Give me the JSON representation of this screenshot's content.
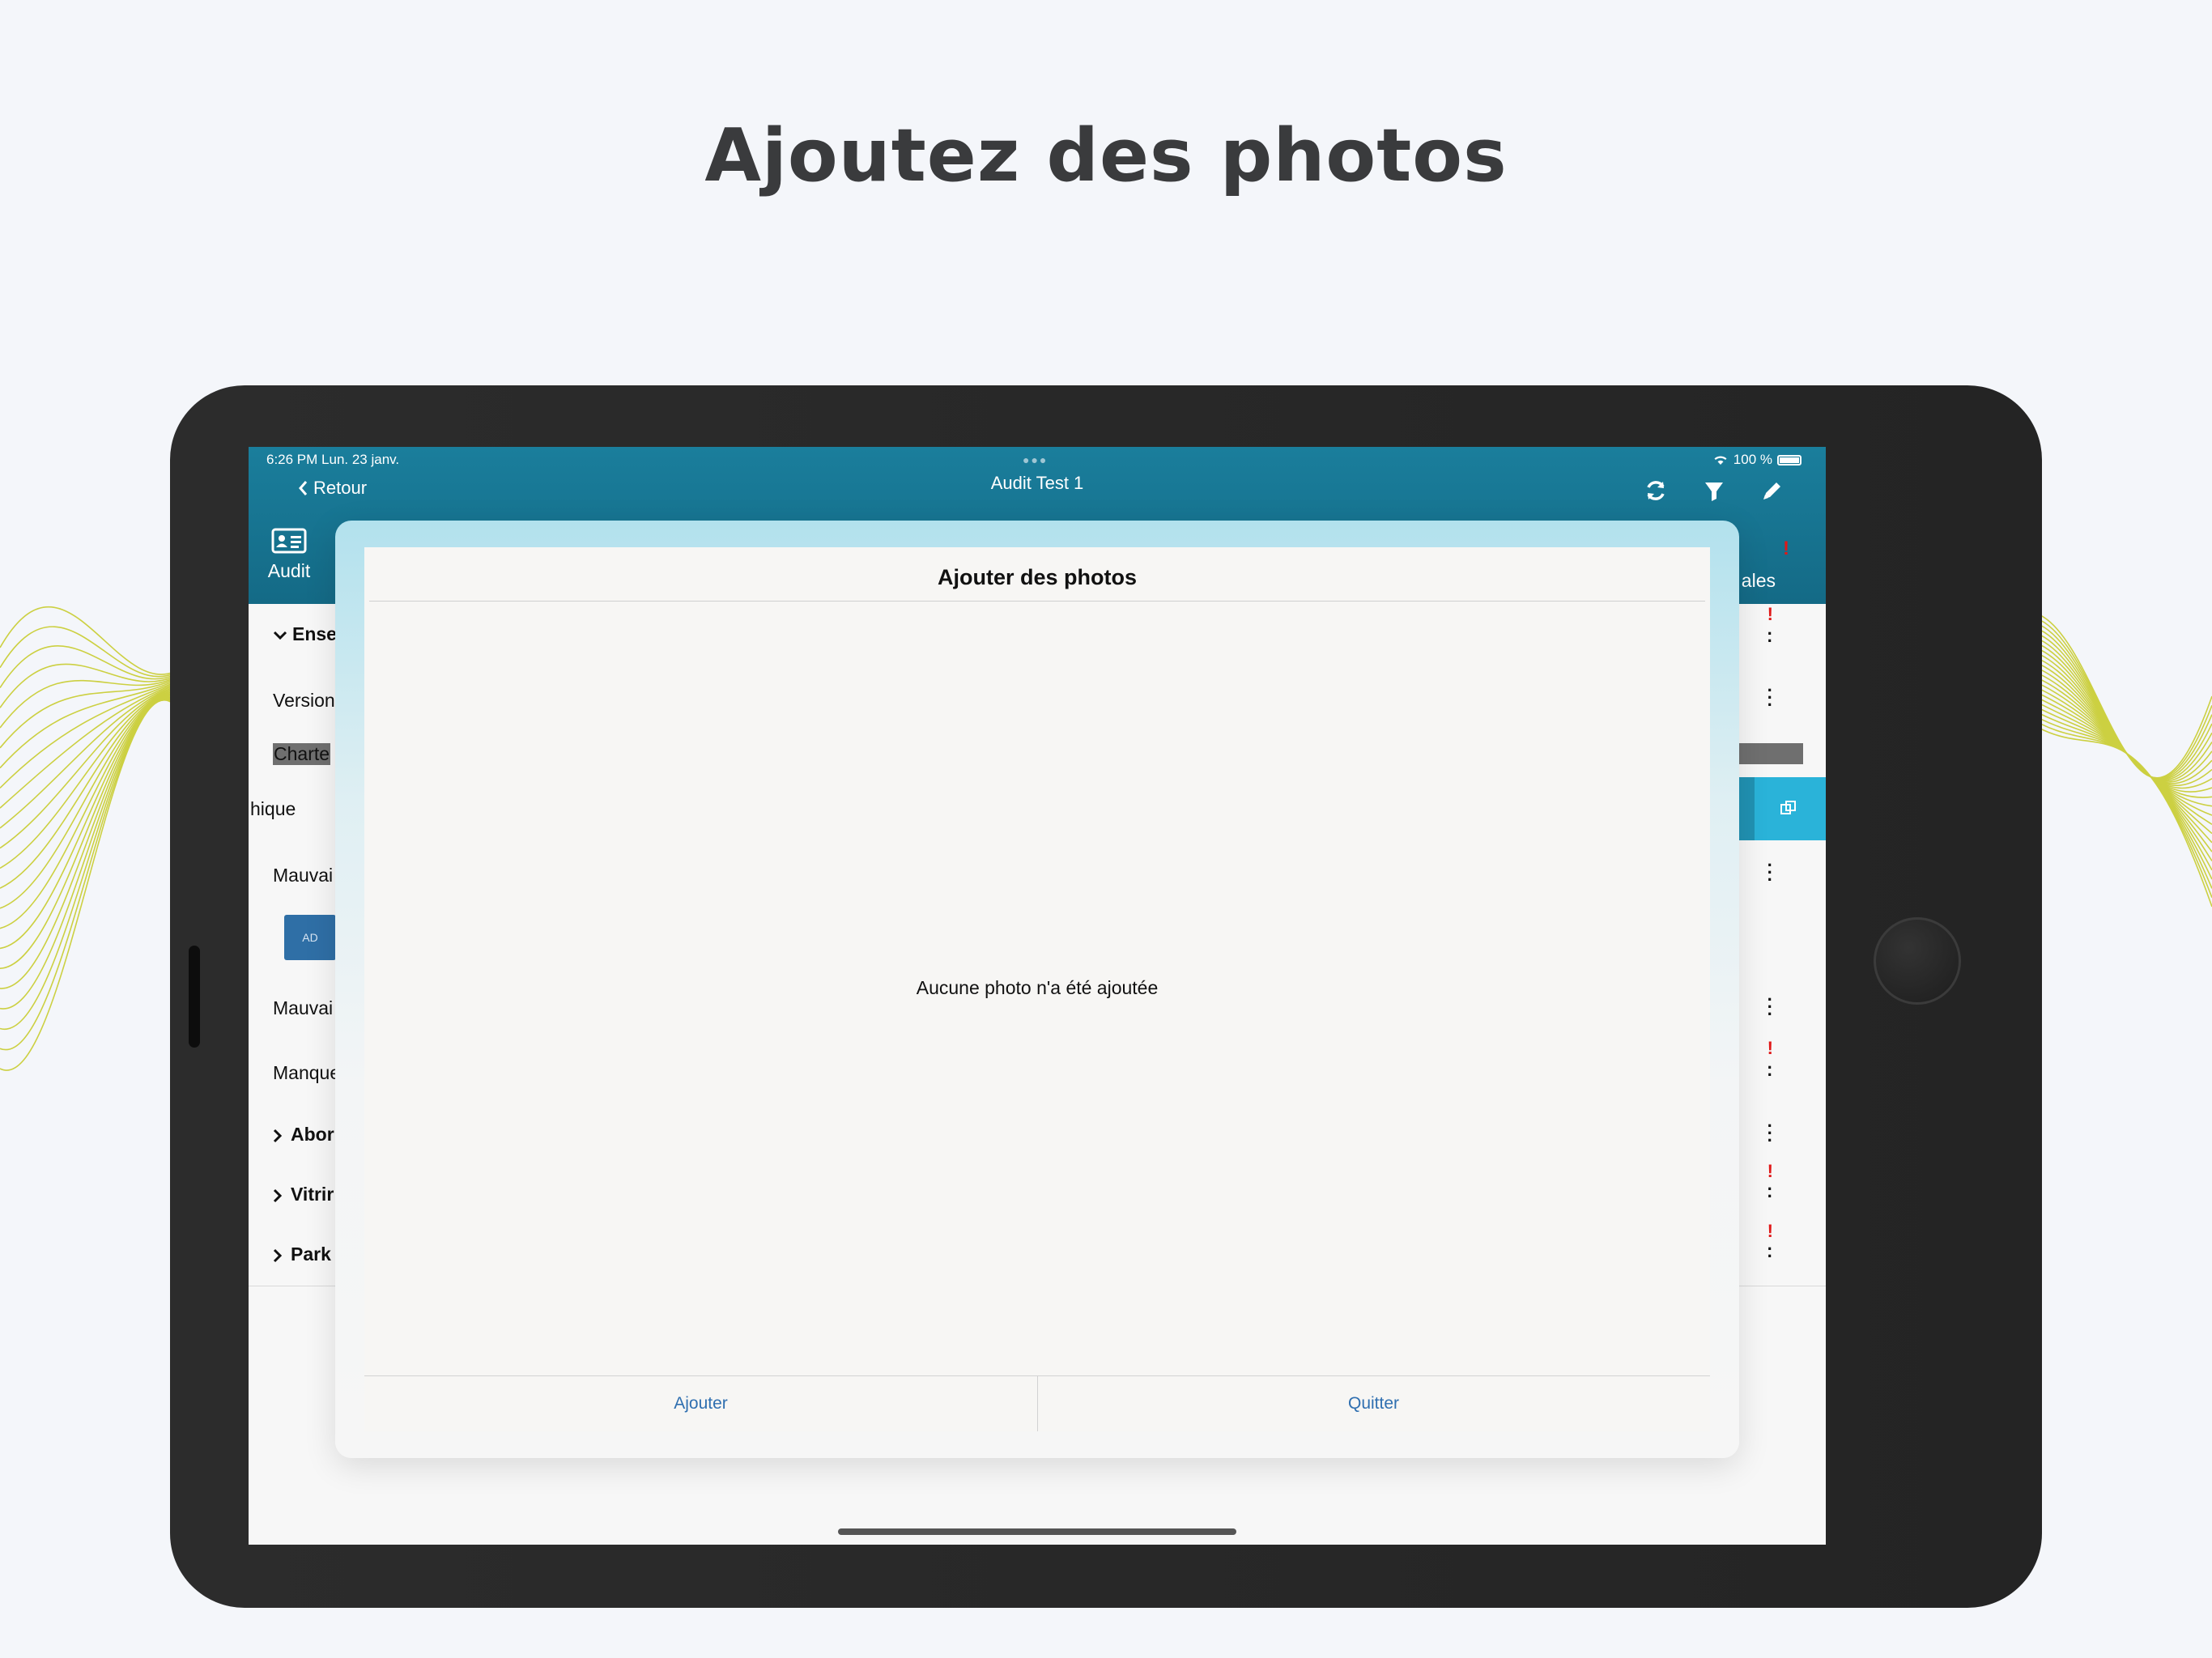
{
  "headline": "Ajoutez des photos",
  "status_bar": {
    "time_date": "6:26 PM   Lun. 23 janv.",
    "battery": "100 %"
  },
  "nav": {
    "back_label": "Retour",
    "title": "Audit Test 1"
  },
  "tabs": {
    "audit_label": "Audit",
    "right_partial_label": "ales"
  },
  "rows": [
    {
      "label": "Ense",
      "bold": true
    },
    {
      "label": "Version"
    },
    {
      "label": "Charte"
    },
    {
      "label": "hique"
    },
    {
      "label": "Mauvai"
    },
    {
      "label": "AD"
    },
    {
      "label": "Mauvai"
    },
    {
      "label": "Manque"
    },
    {
      "label": "Abor",
      "bold": true
    },
    {
      "label": "Vitrir",
      "bold": true
    },
    {
      "label": "Park",
      "bold": true
    }
  ],
  "modal": {
    "title": "Ajouter des photos",
    "empty_message": "Aucune photo n'a été ajoutée",
    "add_button": "Ajouter",
    "quit_button": "Quitter"
  },
  "colors": {
    "accent": "#1a7e9c",
    "modal_link": "#2f6fb0",
    "alert": "#e01818",
    "wave": "#c8cc2e"
  }
}
